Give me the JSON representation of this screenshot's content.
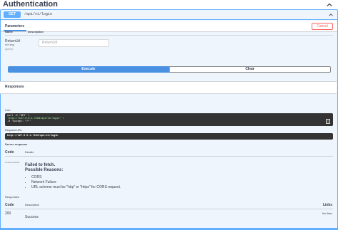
{
  "header": {
    "title": "Authentication"
  },
  "operation": {
    "method": "GET",
    "path": "/api/v1/login"
  },
  "params": {
    "tab_label": "Parameters",
    "cancel_label": "Cancel",
    "col_name": "Name",
    "col_description": "Description",
    "item": {
      "name": "ReturnUrl",
      "type": "string",
      "in": "(query)",
      "placeholder": "ReturnUrl"
    }
  },
  "actions": {
    "execute_label": "Execute",
    "clear_label": "Clear"
  },
  "responses": {
    "title": "Responses",
    "curl_label": "Curl",
    "curl_lines": [
      "curl -X 'GET' \\",
      "  'http://127.0.0.1:7163/api/v1/login' \\",
      "  -H 'accept: */*'"
    ],
    "request_url_label": "Request URL",
    "request_url": "http://127.0.0.1:7163/api/v1/login",
    "server_response_label": "Server response",
    "col_code": "Code",
    "col_details": "Details",
    "undocumented": "Undocumented",
    "error_title": "Failed to fetch.",
    "error_subtitle": "Possible Reasons:",
    "error_reasons": [
      "CORS",
      "Network Failure",
      "URL scheme must be \"http\" or \"https\" for CORS request."
    ],
    "responses_label": "Responses",
    "col_description": "Description",
    "col_links": "Links",
    "rows": [
      {
        "code": "200",
        "description": "Success",
        "links": "No links"
      }
    ]
  },
  "colors": {
    "get_blue": "#61affe",
    "execute_blue": "#4990e2",
    "cancel_red": "#ff6060",
    "code_bg": "#333333"
  }
}
